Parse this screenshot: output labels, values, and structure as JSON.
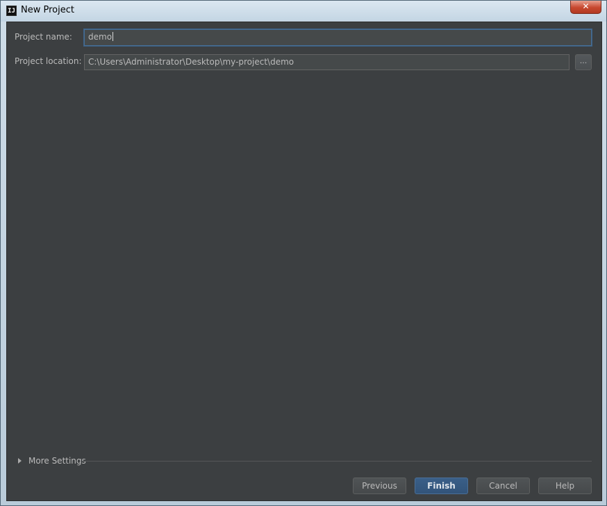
{
  "window": {
    "title": "New Project",
    "app_icon_text": "IJ",
    "close_symbol": "✕"
  },
  "form": {
    "project_name_label": "Project name:",
    "project_name_value": "demo",
    "project_location_label": "Project location:",
    "project_location_value": "C:\\Users\\Administrator\\Desktop\\my-project\\demo",
    "browse_label": "..."
  },
  "more_settings": {
    "label": "More Settings"
  },
  "buttons": {
    "previous": "Previous",
    "finish": "Finish",
    "cancel": "Cancel",
    "help": "Help"
  },
  "colors": {
    "background": "#3c3f41",
    "accent": "#365880",
    "text": "#bbbbbb"
  }
}
